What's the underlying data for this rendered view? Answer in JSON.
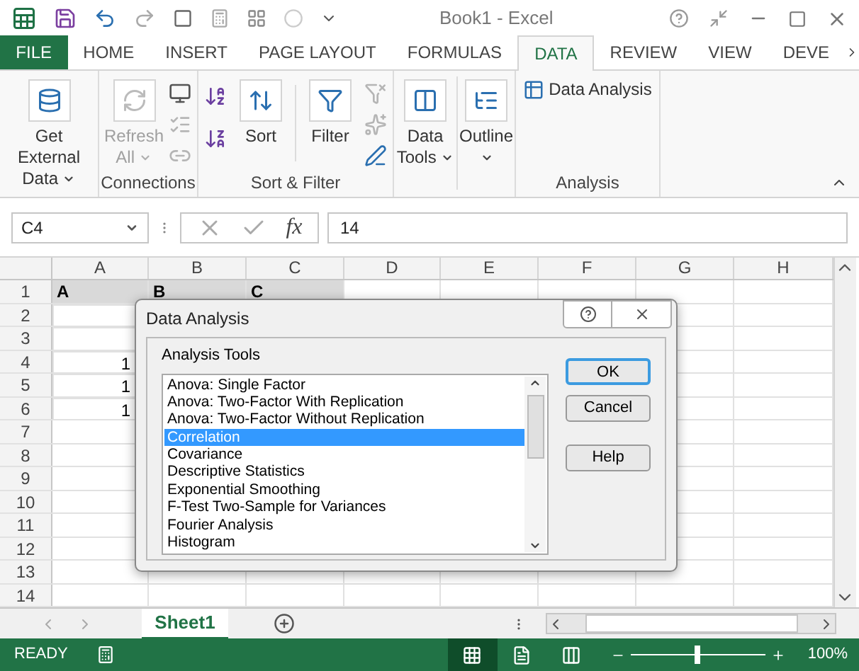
{
  "title_bar": {
    "title": "Book1 - Excel"
  },
  "ribbon_tabs": [
    {
      "label": "FILE",
      "kind": "file",
      "selected": false
    },
    {
      "label": "HOME",
      "kind": "tab",
      "selected": false
    },
    {
      "label": "INSERT",
      "kind": "tab",
      "selected": false
    },
    {
      "label": "PAGE LAYOUT",
      "kind": "tab",
      "selected": false
    },
    {
      "label": "FORMULAS",
      "kind": "tab",
      "selected": false
    },
    {
      "label": "DATA",
      "kind": "tab",
      "selected": true
    },
    {
      "label": "REVIEW",
      "kind": "tab",
      "selected": false
    },
    {
      "label": "VIEW",
      "kind": "tab",
      "selected": false
    },
    {
      "label": "DEVE",
      "kind": "tab",
      "selected": false
    }
  ],
  "ribbon_groups": [
    {
      "kind": "external",
      "buttons": [
        {
          "label": "Get External Data",
          "disabled": false,
          "dropdown": true
        }
      ]
    },
    {
      "kind": "connections",
      "label": "Connections",
      "buttons": [
        {
          "label": "Refresh All",
          "disabled": true,
          "dropdown": true
        }
      ]
    },
    {
      "kind": "sort_filter",
      "label": "Sort & Filter",
      "buttons": [
        {
          "label": "Sort",
          "disabled": false,
          "dropdown": false
        },
        {
          "label": "Filter",
          "disabled": false,
          "dropdown": false
        }
      ]
    },
    {
      "kind": "tools",
      "buttons": [
        {
          "label": "Data Tools",
          "disabled": false,
          "dropdown": true
        },
        {
          "label": "Outline",
          "disabled": false,
          "dropdown": true
        }
      ]
    },
    {
      "kind": "analysis",
      "label": "Analysis",
      "buttons": [
        {
          "label": "Data Analysis",
          "disabled": false,
          "dropdown": false
        }
      ]
    }
  ],
  "formula_bar": {
    "name_box": "C4",
    "function_button": "fx",
    "formula": "14"
  },
  "sheet": {
    "columns": [
      "A",
      "B",
      "C",
      "D",
      "E",
      "F",
      "G",
      "H"
    ],
    "rows": [
      {
        "number": "1",
        "kind": "heading",
        "cells": [
          "A",
          "B",
          "C"
        ]
      },
      {
        "number": "2",
        "kind": "data"
      },
      {
        "number": "3",
        "kind": "data"
      },
      {
        "number": "4",
        "kind": "data",
        "cells": [
          "1"
        ]
      },
      {
        "number": "5",
        "kind": "data",
        "cells": [
          "1"
        ]
      },
      {
        "number": "6",
        "kind": "data",
        "cells": [
          "1"
        ]
      },
      {
        "number": "7",
        "kind": "plain"
      },
      {
        "number": "8",
        "kind": "plain"
      },
      {
        "number": "9",
        "kind": "plain"
      },
      {
        "number": "10",
        "kind": "plain"
      },
      {
        "number": "11",
        "kind": "plain"
      },
      {
        "number": "12",
        "kind": "plain"
      },
      {
        "number": "13",
        "kind": "plain"
      },
      {
        "number": "14",
        "kind": "plain"
      }
    ]
  },
  "sheet_tabs": [
    {
      "label": "Sheet1",
      "selected": true
    }
  ],
  "dialog": {
    "title": "Data Analysis",
    "group_label": "Analysis Tools",
    "tools": [
      {
        "label": "Anova: Single Factor",
        "selected": false
      },
      {
        "label": "Anova: Two-Factor With Replication",
        "selected": false
      },
      {
        "label": "Anova: Two-Factor Without Replication",
        "selected": false
      },
      {
        "label": "Correlation",
        "selected": true
      },
      {
        "label": "Covariance",
        "selected": false
      },
      {
        "label": "Descriptive Statistics",
        "selected": false
      },
      {
        "label": "Exponential Smoothing",
        "selected": false
      },
      {
        "label": "F-Test Two-Sample for Variances",
        "selected": false
      },
      {
        "label": "Fourier Analysis",
        "selected": false
      },
      {
        "label": "Histogram",
        "selected": false
      }
    ],
    "buttons": [
      {
        "label": "OK",
        "default": true
      },
      {
        "label": "Cancel",
        "default": false
      },
      {
        "label": "Help",
        "default": false
      }
    ]
  },
  "status_bar": {
    "status": "READY",
    "views": [
      {
        "kind": "normal",
        "selected": true
      },
      {
        "kind": "page_layout",
        "selected": false
      },
      {
        "kind": "page_break",
        "selected": false
      }
    ],
    "zoom": {
      "level": 0.5,
      "reading": "100%"
    }
  }
}
